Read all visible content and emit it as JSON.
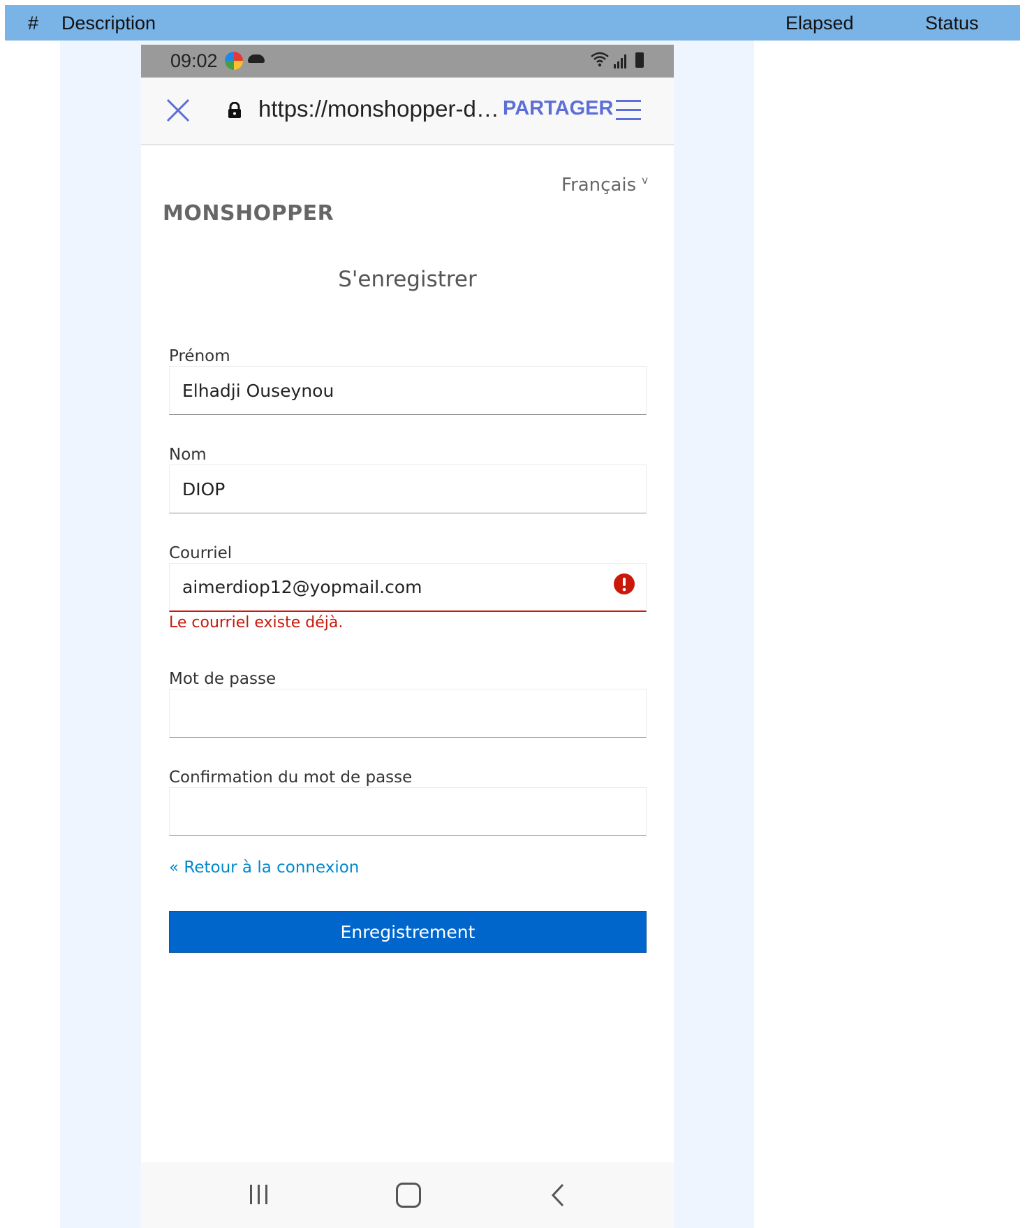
{
  "report": {
    "columns": {
      "hash": "#",
      "description": "Description",
      "elapsed": "Elapsed",
      "status": "Status"
    }
  },
  "statusbar": {
    "time": "09:02"
  },
  "browser": {
    "url": "https://monshopper-d…",
    "share_label": "PARTAGER"
  },
  "page": {
    "language": "Français",
    "brand": "MONSHOPPER",
    "title": "S'enregistrer",
    "fields": {
      "first_name": {
        "label": "Prénom",
        "value": "Elhadji Ouseynou"
      },
      "last_name": {
        "label": "Nom",
        "value": "DIOP"
      },
      "email": {
        "label": "Courriel",
        "value": "aimerdiop12@yopmail.com",
        "error": "Le courriel existe déjà."
      },
      "password": {
        "label": "Mot de passe",
        "value": ""
      },
      "password_confirm": {
        "label": "Confirmation du mot de passe",
        "value": ""
      }
    },
    "back_link": "« Retour à la connexion",
    "submit_label": "Enregistrement"
  },
  "colors": {
    "header_bar": "#7ab3e6",
    "accent_share": "#5c6ed8",
    "error": "#c9190b",
    "link": "#0088ce",
    "primary_button": "#0066cc"
  }
}
